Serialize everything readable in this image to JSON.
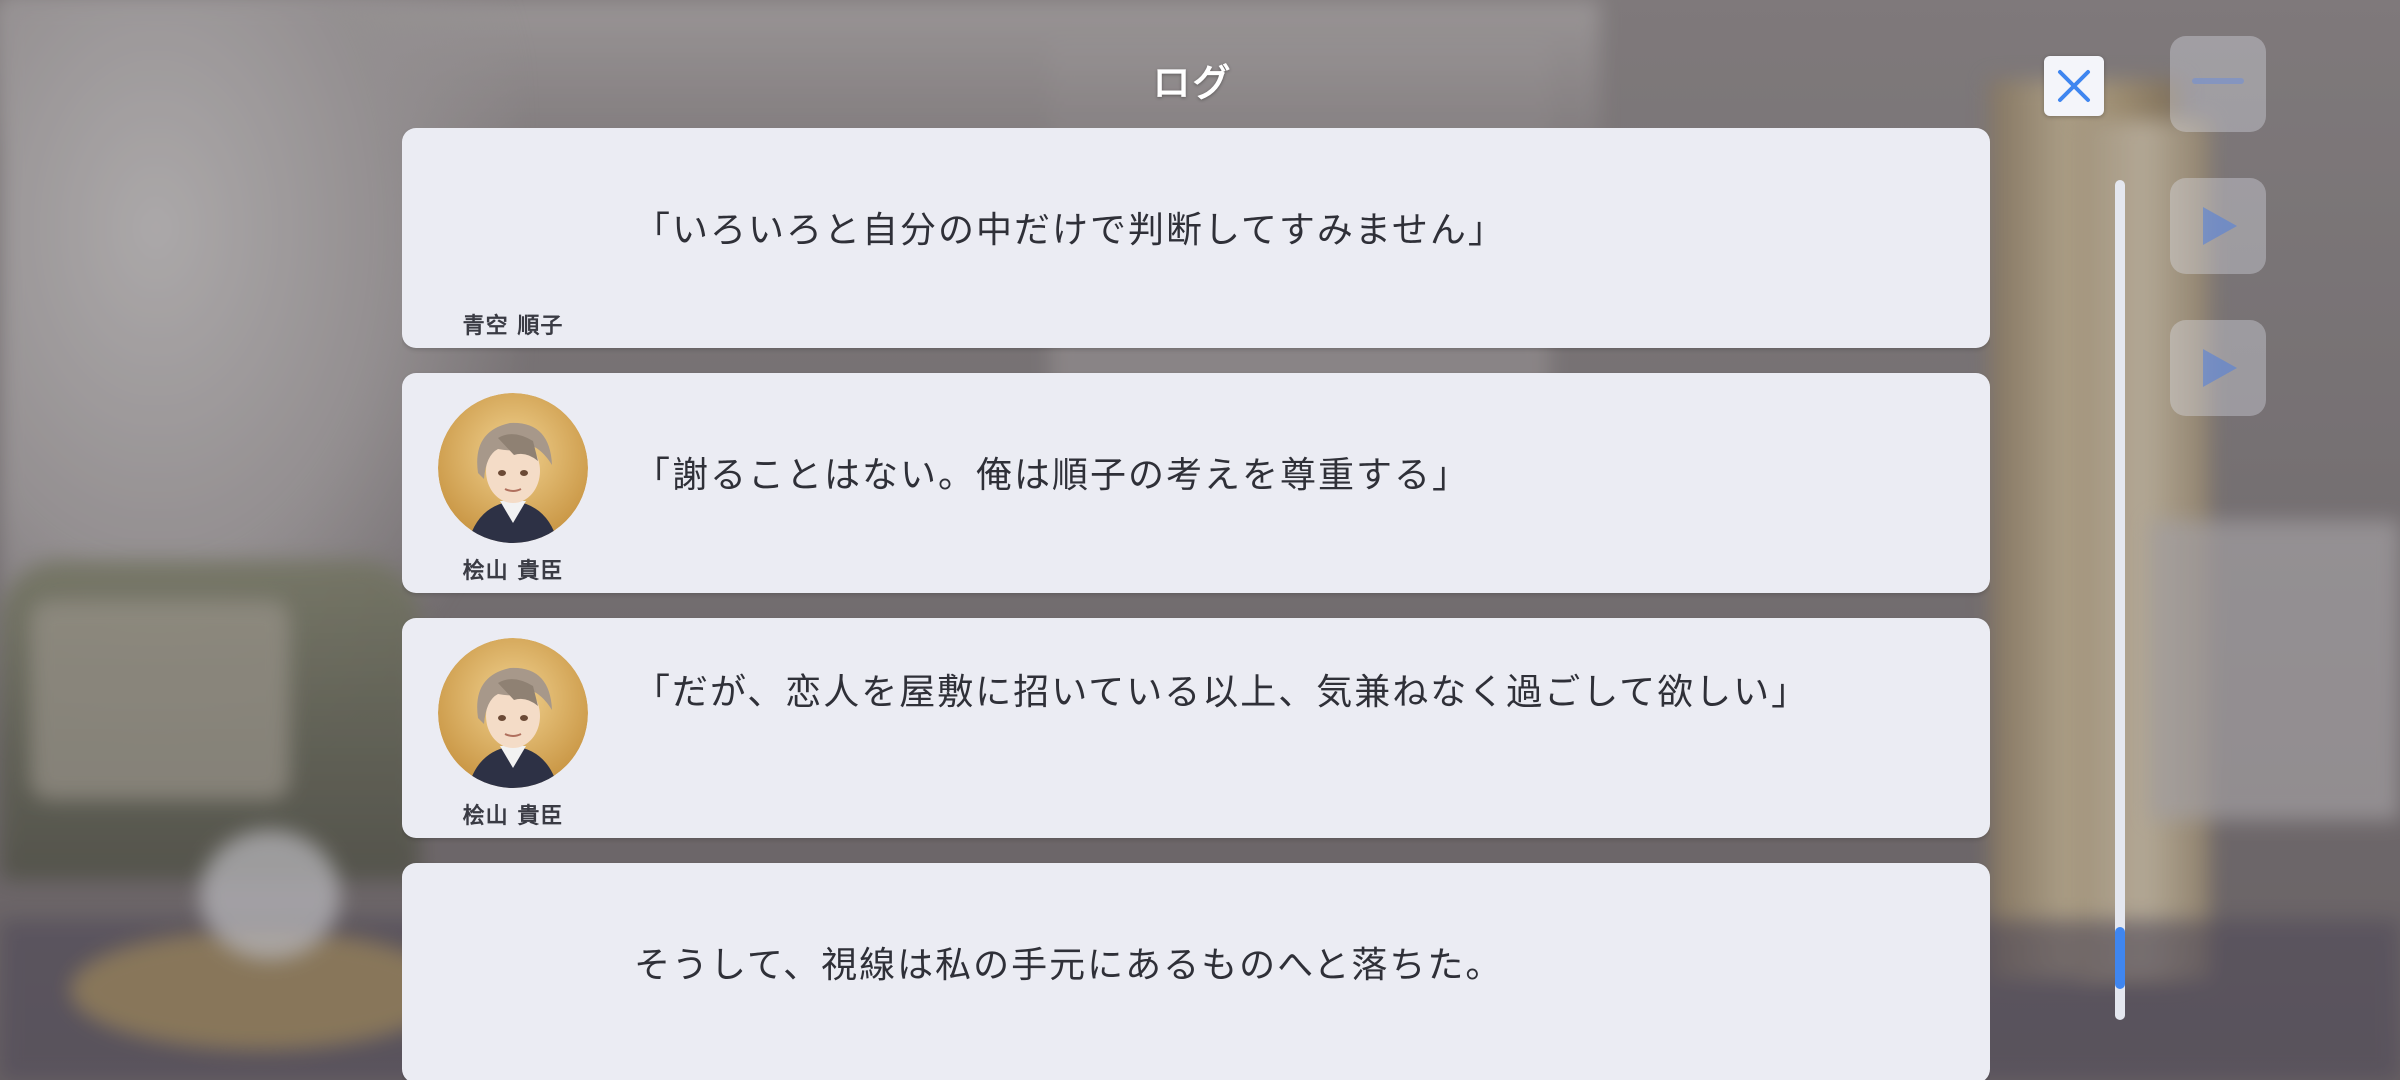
{
  "log": {
    "title": "ログ",
    "entries": [
      {
        "speaker": "青空 順子",
        "text": "「いろいろと自分の中だけで判断してすみません」",
        "has_avatar": false
      },
      {
        "speaker": "桧山 貴臣",
        "text": "「謝ることはない。俺は順子の考えを尊重する」",
        "has_avatar": true
      },
      {
        "speaker": "桧山 貴臣",
        "text": "「だが、恋人を屋敷に招いている以上、気兼ねなく過ごして欲しい」",
        "has_avatar": true
      },
      {
        "speaker": "",
        "text": "そうして、視線は私の手元にあるものへと落ちた。",
        "has_avatar": false
      }
    ],
    "scroll_position": 0.96
  },
  "colors": {
    "card_bg": "#ebecf3",
    "text": "#2f3038",
    "accent": "#3f86f0",
    "close_icon": "#3f86f0"
  },
  "icons": {
    "close": "close-icon",
    "auto": "play-icon",
    "skip": "play-icon",
    "menu": "menu-icon"
  }
}
